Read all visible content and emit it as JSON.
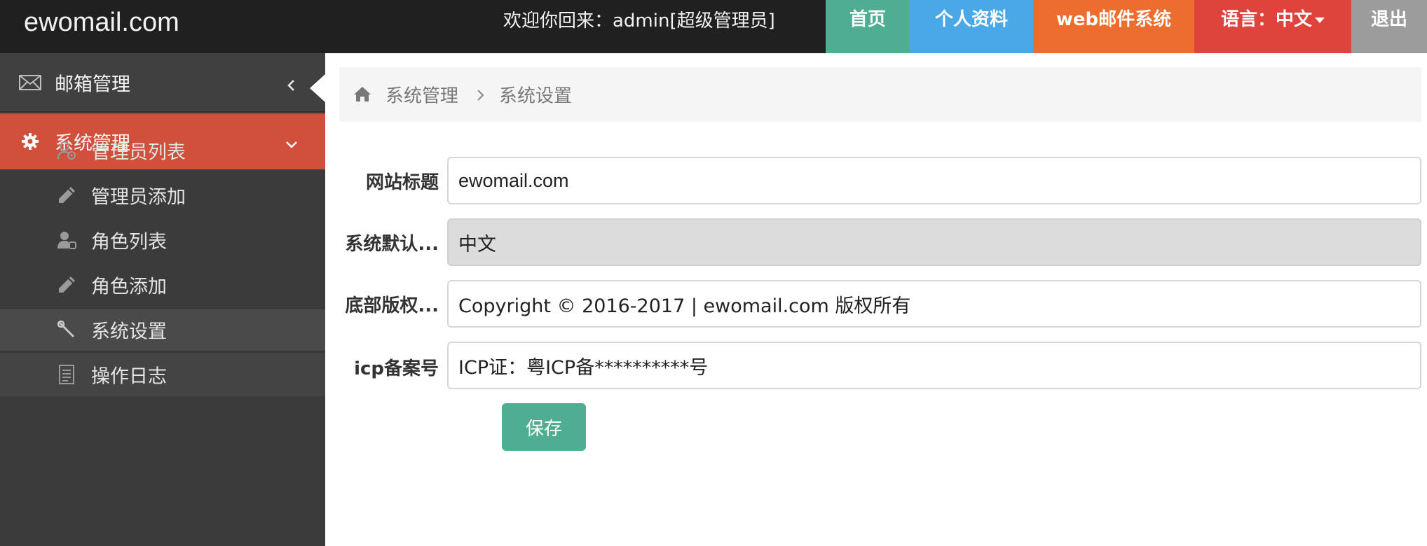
{
  "header": {
    "logo": "ewomail.com",
    "welcome": "欢迎你回来：admin[超级管理员]",
    "nav": [
      {
        "label": "首页",
        "color": "#4fae91"
      },
      {
        "label": "个人资料",
        "color": "#4aa8e6"
      },
      {
        "label": "web邮件系统",
        "color": "#ed6d2e"
      },
      {
        "label": "语言：中文",
        "color": "#df443c"
      },
      {
        "label": "退出",
        "color": "#9c9c9c"
      }
    ]
  },
  "sidebar": {
    "groups": [
      {
        "label": "邮箱管理",
        "icon": "envelope-icon",
        "state": "collapsed"
      },
      {
        "label": "系统管理",
        "icon": "gear-icon",
        "state": "expanded",
        "color": "#d0503c"
      }
    ],
    "items": [
      {
        "label": "管理员列表",
        "icon": "admin-user-icon"
      },
      {
        "label": "管理员添加",
        "icon": "pencil-icon"
      },
      {
        "label": "角色列表",
        "icon": "role-user-icon"
      },
      {
        "label": "角色添加",
        "icon": "pencil-icon"
      },
      {
        "label": "系统设置",
        "icon": "wrench-icon",
        "active": true
      },
      {
        "label": "操作日志",
        "icon": "document-icon"
      }
    ]
  },
  "breadcrumb": {
    "home_icon": "home-icon",
    "items": [
      "系统管理",
      "系统设置"
    ]
  },
  "form": {
    "fields": [
      {
        "label": "网站标题",
        "value": "ewomail.com"
      },
      {
        "label": "系统默认...",
        "value": "中文",
        "readonly": true
      },
      {
        "label": "底部版权...",
        "value": "Copyright © 2016-2017 | ewomail.com 版权所有"
      },
      {
        "label": "icp备案号",
        "value": "ICP证：粤ICP备**********号"
      }
    ],
    "save_label": "保存",
    "save_color": "#4fae91"
  }
}
